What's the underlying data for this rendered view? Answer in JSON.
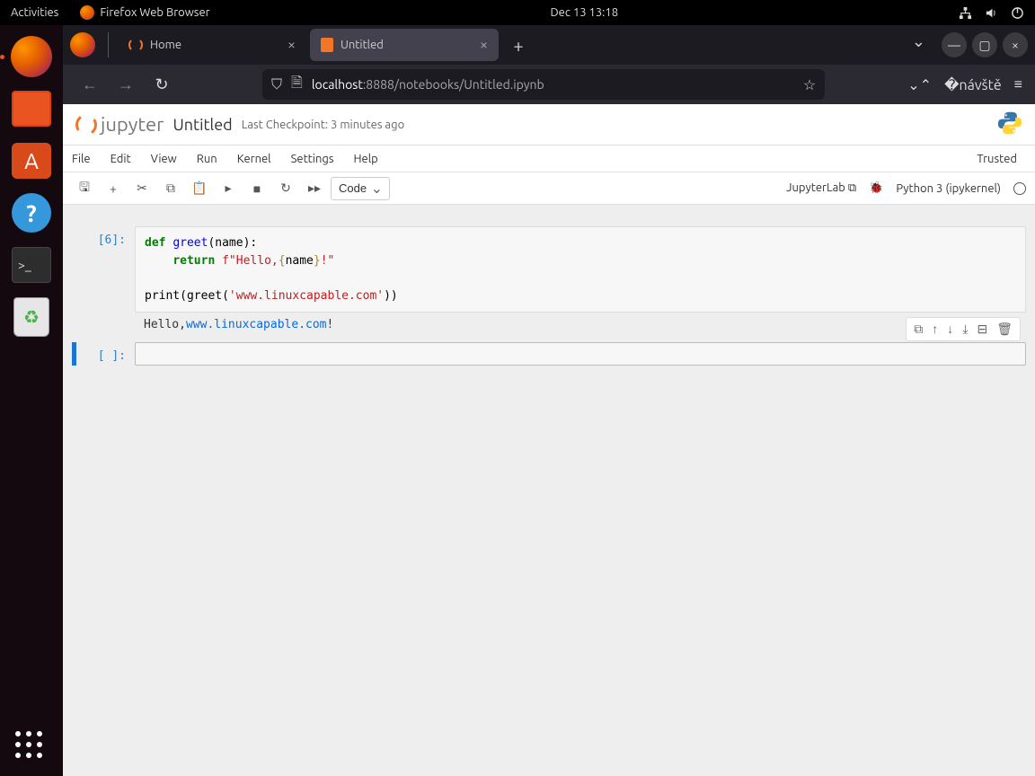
{
  "topbar": {
    "activities": "Activities",
    "app_name": "Firefox Web Browser",
    "datetime": "Dec 13  13:18"
  },
  "firefox": {
    "tabs": [
      {
        "label": "Home",
        "active": false
      },
      {
        "label": "Untitled",
        "active": true
      }
    ],
    "url_host": "localhost",
    "url_rest": ":8888/notebooks/Untitled.ipynb"
  },
  "jupyter": {
    "brand": "jupyter",
    "title": "Untitled",
    "checkpoint": "Last Checkpoint: 3 minutes ago",
    "trusted": "Trusted",
    "menu": [
      "File",
      "Edit",
      "View",
      "Run",
      "Kernel",
      "Settings",
      "Help"
    ],
    "celltype": "Code",
    "jupyterlab_link": "JupyterLab",
    "kernel": "Python 3 (ipykernel)",
    "cells": [
      {
        "prompt": "[6]:",
        "code_tokens": [
          {
            "t": "def ",
            "c": "kw"
          },
          {
            "t": "greet",
            "c": "fn"
          },
          {
            "t": "(name):",
            "c": ""
          },
          {
            "t": "\n    ",
            "c": ""
          },
          {
            "t": "return ",
            "c": "kw"
          },
          {
            "t": "f\"Hello,",
            "c": "str"
          },
          {
            "t": "{",
            "c": "interp"
          },
          {
            "t": "name",
            "c": ""
          },
          {
            "t": "}",
            "c": "interp"
          },
          {
            "t": "!\"",
            "c": "str"
          },
          {
            "t": "\n\n",
            "c": ""
          },
          {
            "t": "print(greet(",
            "c": ""
          },
          {
            "t": "'www.linuxcapable.com'",
            "c": "str"
          },
          {
            "t": "))",
            "c": ""
          }
        ],
        "output_prefix": "Hello,",
        "output_link": "www.linuxcapable.com",
        "output_suffix": "!"
      },
      {
        "prompt": "[ ]:",
        "empty": true
      }
    ]
  }
}
